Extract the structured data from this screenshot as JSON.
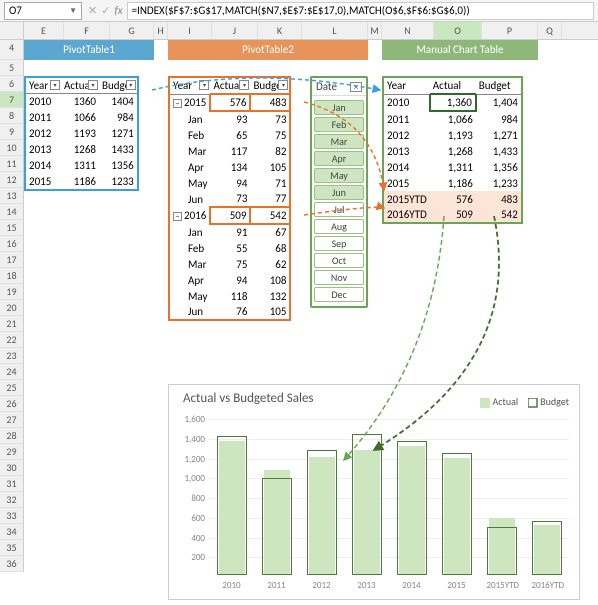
{
  "name_box": "O7",
  "formula": "=INDEX($F$7:$G$17,MATCH($N7,$E$7:$E$17,0),MATCH(O$6,$F$6:$G$6,0))",
  "cols": [
    "E",
    "F",
    "G",
    "H",
    "I",
    "J",
    "K",
    "L",
    "M",
    "N",
    "O",
    "P",
    "Q"
  ],
  "rows": [
    4,
    5,
    6,
    7,
    8,
    9,
    10,
    11,
    12,
    13,
    14,
    15,
    16,
    17,
    18,
    19,
    20,
    21,
    22,
    23,
    24,
    25,
    26,
    27,
    28,
    29,
    30,
    31,
    32,
    33,
    34,
    35,
    36
  ],
  "bands": {
    "pt1": "PivotTable1",
    "pt2": "PivotTable2",
    "manual": "Manual Chart Table"
  },
  "pivot1": {
    "headers": [
      "Year",
      "Actual",
      "Budget"
    ],
    "rows": [
      {
        "year": "2010",
        "actual": 1360,
        "budget": 1404
      },
      {
        "year": "2011",
        "actual": 1066,
        "budget": 984
      },
      {
        "year": "2012",
        "actual": 1193,
        "budget": 1271
      },
      {
        "year": "2013",
        "actual": 1268,
        "budget": 1433
      },
      {
        "year": "2014",
        "actual": 1311,
        "budget": 1356
      },
      {
        "year": "2015",
        "actual": 1186,
        "budget": 1233
      }
    ]
  },
  "pivot2": {
    "headers": [
      "Year",
      "Actual",
      "Budget"
    ],
    "groups": [
      {
        "year": "2015",
        "actual": 576,
        "budget": 483,
        "months": [
          {
            "m": "Jan",
            "a": 93,
            "b": 73
          },
          {
            "m": "Feb",
            "a": 65,
            "b": 75
          },
          {
            "m": "Mar",
            "a": 117,
            "b": 82
          },
          {
            "m": "Apr",
            "a": 134,
            "b": 105
          },
          {
            "m": "May",
            "a": 94,
            "b": 71
          },
          {
            "m": "Jun",
            "a": 73,
            "b": 77
          }
        ]
      },
      {
        "year": "2016",
        "actual": 509,
        "budget": 542,
        "months": [
          {
            "m": "Jan",
            "a": 91,
            "b": 67
          },
          {
            "m": "Feb",
            "a": 55,
            "b": 68
          },
          {
            "m": "Mar",
            "a": 75,
            "b": 62
          },
          {
            "m": "Apr",
            "a": 94,
            "b": 108
          },
          {
            "m": "May",
            "a": 118,
            "b": 132
          },
          {
            "m": "Jun",
            "a": 76,
            "b": 105
          }
        ]
      }
    ]
  },
  "slicer": {
    "title": "Date",
    "items": [
      {
        "label": "Jan",
        "on": true
      },
      {
        "label": "Feb",
        "on": true
      },
      {
        "label": "Mar",
        "on": true
      },
      {
        "label": "Apr",
        "on": true
      },
      {
        "label": "May",
        "on": true
      },
      {
        "label": "Jun",
        "on": true
      },
      {
        "label": "Jul",
        "on": false
      },
      {
        "label": "Aug",
        "on": false
      },
      {
        "label": "Sep",
        "on": false
      },
      {
        "label": "Oct",
        "on": false
      },
      {
        "label": "Nov",
        "on": false
      },
      {
        "label": "Dec",
        "on": false
      }
    ]
  },
  "manual": {
    "headers": [
      "Year",
      "Actual",
      "Budget"
    ],
    "rows": [
      {
        "year": "2010",
        "actual": "1,360",
        "budget": "1,404",
        "ytd": false
      },
      {
        "year": "2011",
        "actual": "1,066",
        "budget": "984",
        "ytd": false
      },
      {
        "year": "2012",
        "actual": "1,193",
        "budget": "1,271",
        "ytd": false
      },
      {
        "year": "2013",
        "actual": "1,268",
        "budget": "1,433",
        "ytd": false
      },
      {
        "year": "2014",
        "actual": "1,311",
        "budget": "1,356",
        "ytd": false
      },
      {
        "year": "2015",
        "actual": "1,186",
        "budget": "1,233",
        "ytd": false
      },
      {
        "year": "2015YTD",
        "actual": "576",
        "budget": "483",
        "ytd": true
      },
      {
        "year": "2016YTD",
        "actual": "509",
        "budget": "542",
        "ytd": true
      }
    ]
  },
  "chart_data": {
    "type": "bar",
    "title": "Actual vs Budgeted Sales",
    "legend": [
      "Actual",
      "Budget"
    ],
    "categories": [
      "2010",
      "2011",
      "2012",
      "2013",
      "2014",
      "2015",
      "2015YTD",
      "2016YTD"
    ],
    "series": [
      {
        "name": "Actual",
        "values": [
          1360,
          1066,
          1193,
          1268,
          1311,
          1186,
          576,
          509
        ]
      },
      {
        "name": "Budget",
        "values": [
          1404,
          984,
          1271,
          1433,
          1356,
          1233,
          483,
          542
        ]
      }
    ],
    "ylim": [
      0,
      1600
    ],
    "yticks": [
      200,
      400,
      600,
      800,
      1000,
      1200,
      1400,
      1600
    ]
  }
}
